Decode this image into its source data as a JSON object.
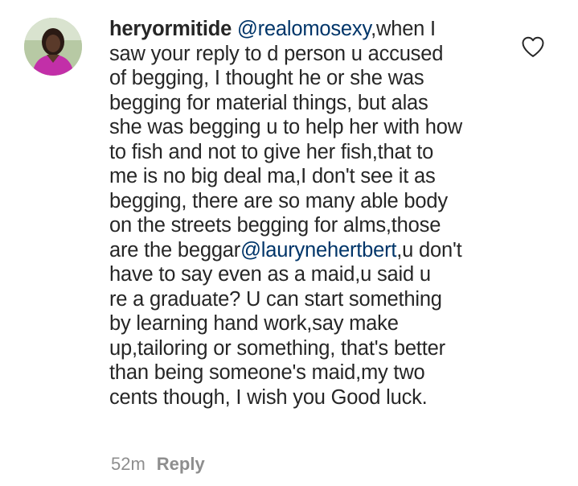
{
  "comment": {
    "username": "heryormitide",
    "mention_1": "@realomosexy",
    "line_1_rest": ",when I",
    "line_2": "saw your reply to d person u accused",
    "line_3": "of begging, I thought he or she was",
    "line_4": "begging for material things, but alas",
    "line_5": "she was begging u to help her with how",
    "line_6": "to fish and not to give her fish,that to",
    "line_7": "me is no big deal ma,I don't see it as",
    "line_8": "begging, there are so many able body",
    "line_9": "on the streets begging for alms,those",
    "line_10_start": "are the beggar",
    "mention_2": "@laurynehertbert",
    "line_10_rest": ",u don't",
    "line_11": "have to say even as a maid,u said u",
    "line_12": "re a graduate? U can start something",
    "line_13": "by learning hand work,say make",
    "line_14": "up,tailoring or something, that's better",
    "line_15": "than being someone's maid,my two",
    "line_16": "cents though, I wish you Good luck.",
    "timestamp": "52m",
    "reply_label": "Reply",
    "like_icon": "heart-outline-icon"
  },
  "colors": {
    "text": "#262626",
    "mention": "#003569",
    "meta": "#8e8e8e",
    "avatar_ring": "#c9d6b9"
  }
}
